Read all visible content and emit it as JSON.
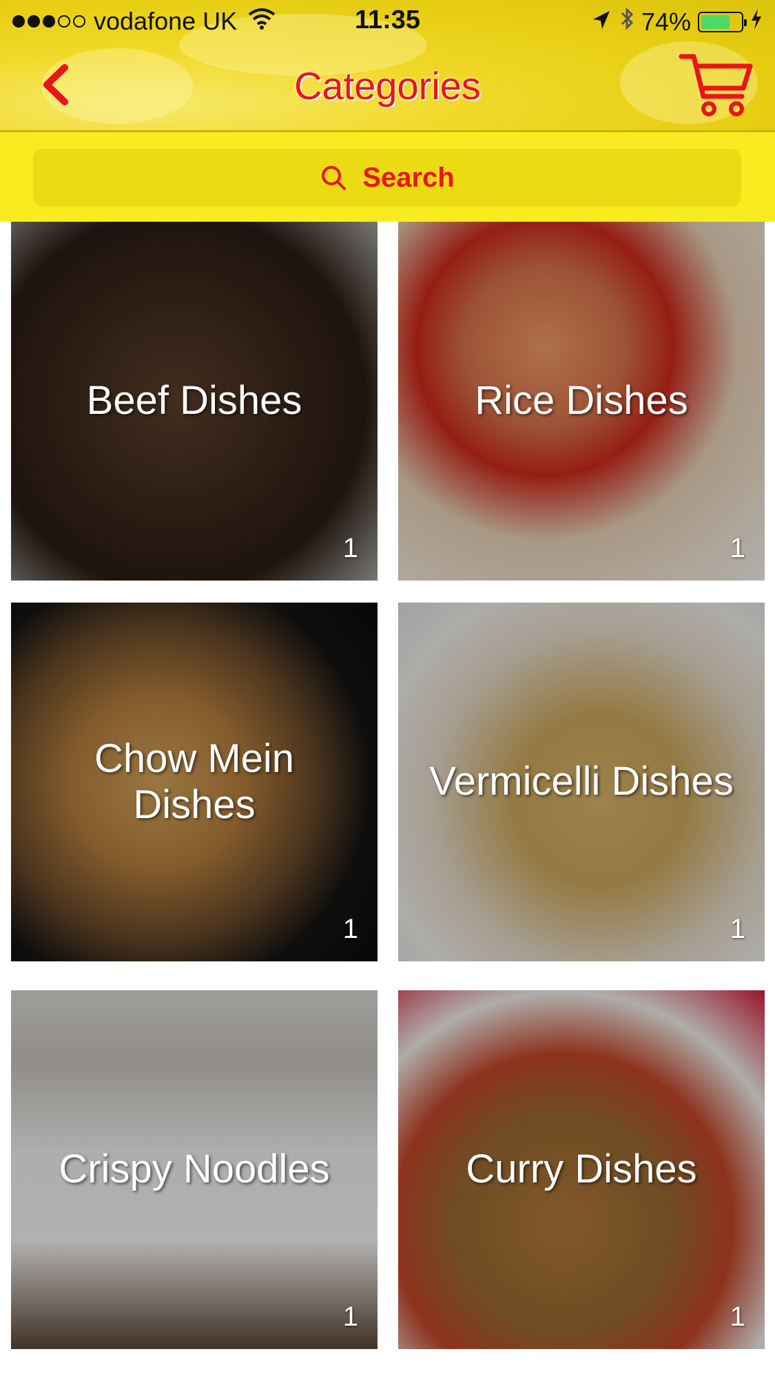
{
  "status_bar": {
    "carrier": "vodafone UK",
    "time": "11:35",
    "battery_percent": "74%",
    "battery_level": 0.74
  },
  "header": {
    "title": "Categories",
    "back_icon": "chevron-left-icon",
    "cart_icon": "cart-icon",
    "accent_color": "#e8151b",
    "bar_color": "#f1d92a"
  },
  "search": {
    "label": "Search",
    "icon": "search-icon"
  },
  "categories": [
    {
      "name": "Beef Dishes",
      "count": "1"
    },
    {
      "name": "Rice Dishes",
      "count": "1"
    },
    {
      "name": "Chow Mein Dishes",
      "count": "1"
    },
    {
      "name": "Vermicelli Dishes",
      "count": "1"
    },
    {
      "name": "Crispy Noodles",
      "count": "1"
    },
    {
      "name": "Curry Dishes",
      "count": "1"
    }
  ]
}
